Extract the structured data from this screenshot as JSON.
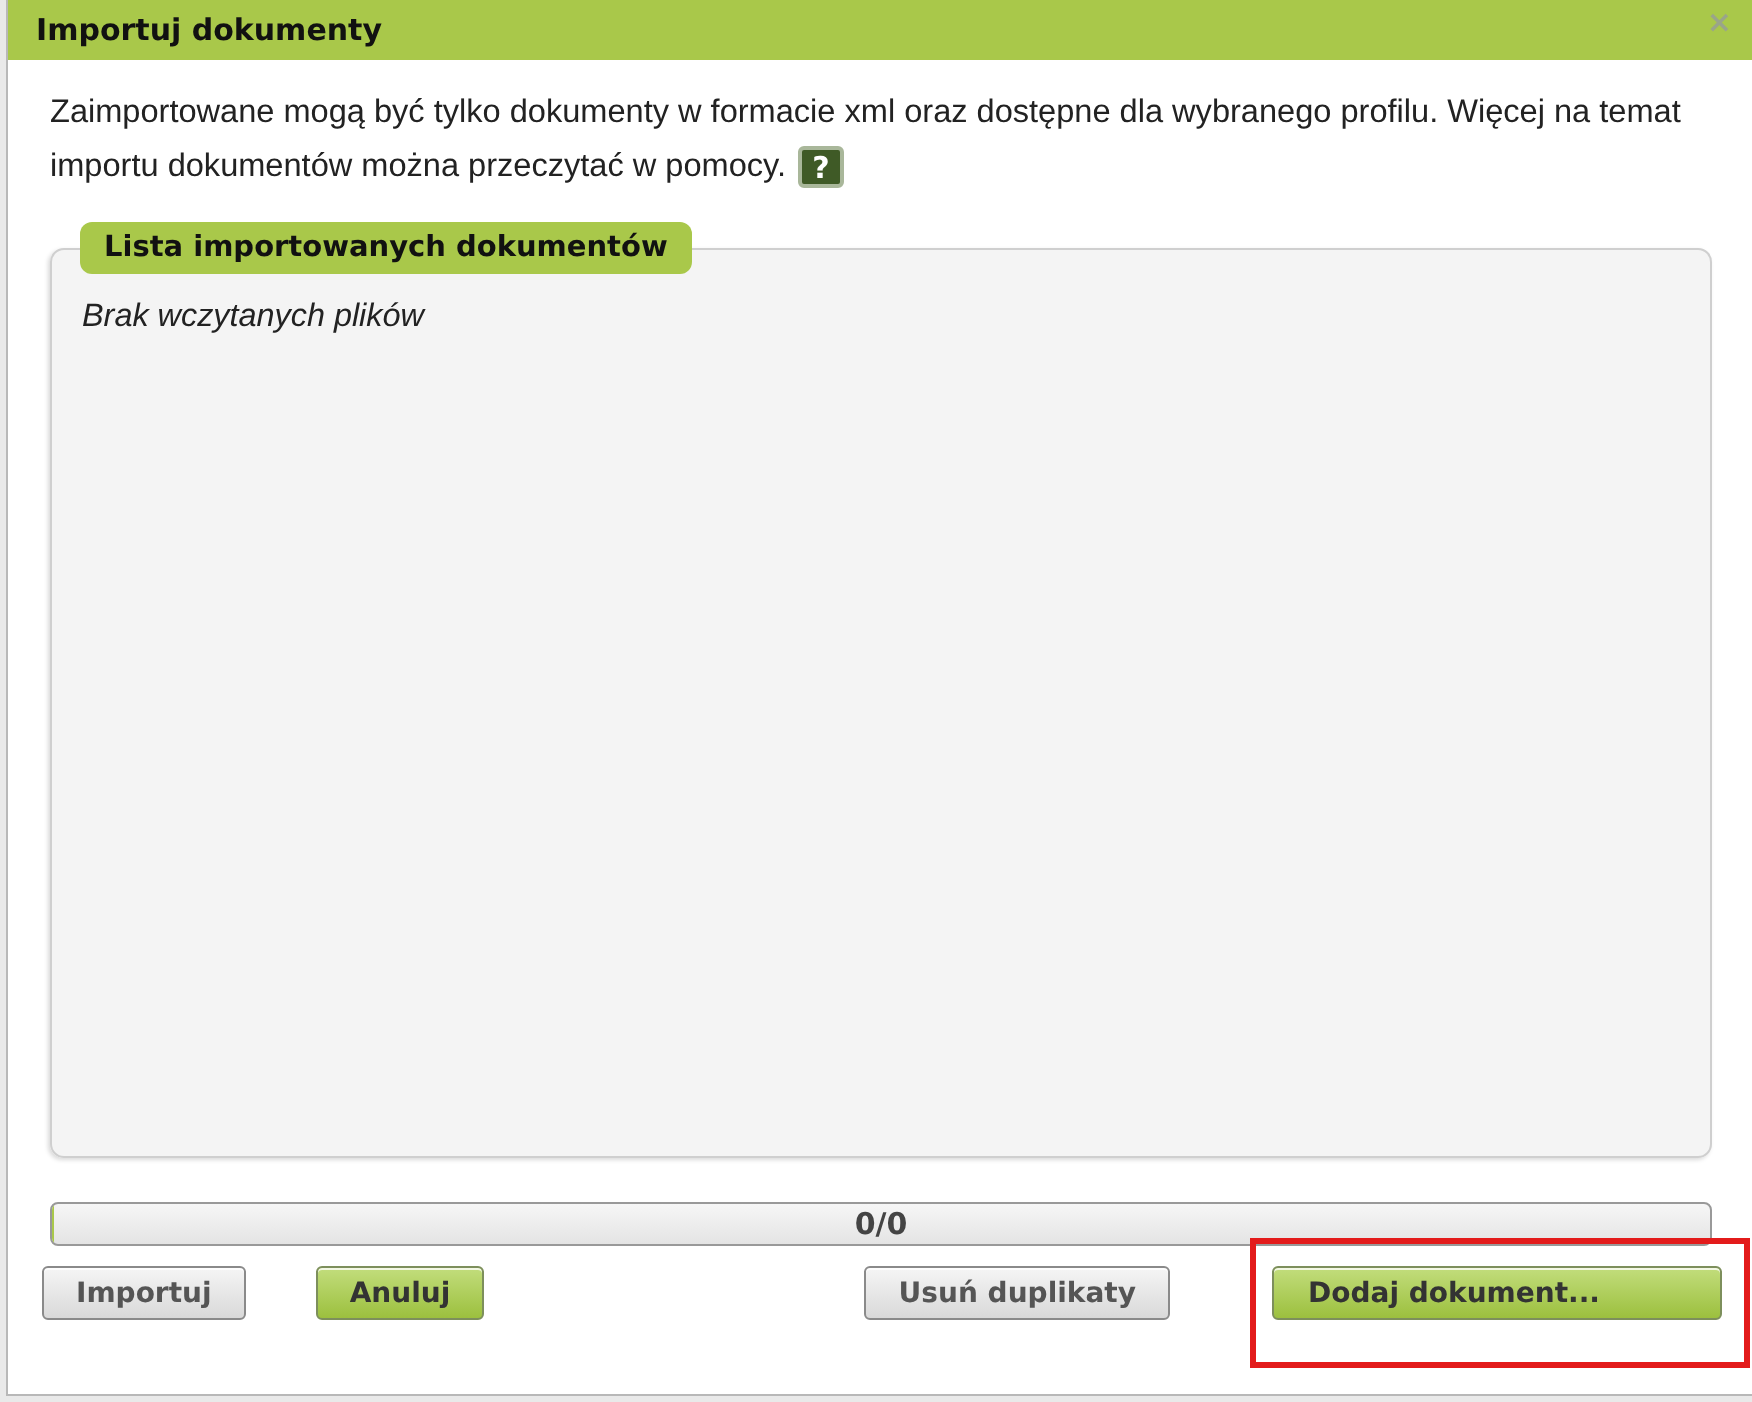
{
  "window": {
    "title": "Importuj dokumenty",
    "close": "×"
  },
  "intro": {
    "lines": [
      "Zaimportowane mogą być tylko dokumenty w formacie xml oraz dostępne dla wybranego profilu. Więcej na temat",
      "importu dokumentów można przeczytać w pomocy."
    ],
    "help": "?"
  },
  "file_list": {
    "title": "Lista importowanych dokumentów",
    "empty_message": "Brak wczytanych plików"
  },
  "progress": {
    "level": 0,
    "reading": "0/0"
  },
  "left_buttons": [
    {
      "label": "Importuj",
      "kind": "default",
      "highlighted": false
    },
    {
      "label": "Anuluj",
      "kind": "primary",
      "highlighted": false
    }
  ],
  "right_buttons": [
    {
      "label": "Usuń duplikaty",
      "kind": "default",
      "highlighted": false
    },
    {
      "label": "Dodaj dokument...",
      "kind": "primary",
      "highlighted": true
    }
  ]
}
